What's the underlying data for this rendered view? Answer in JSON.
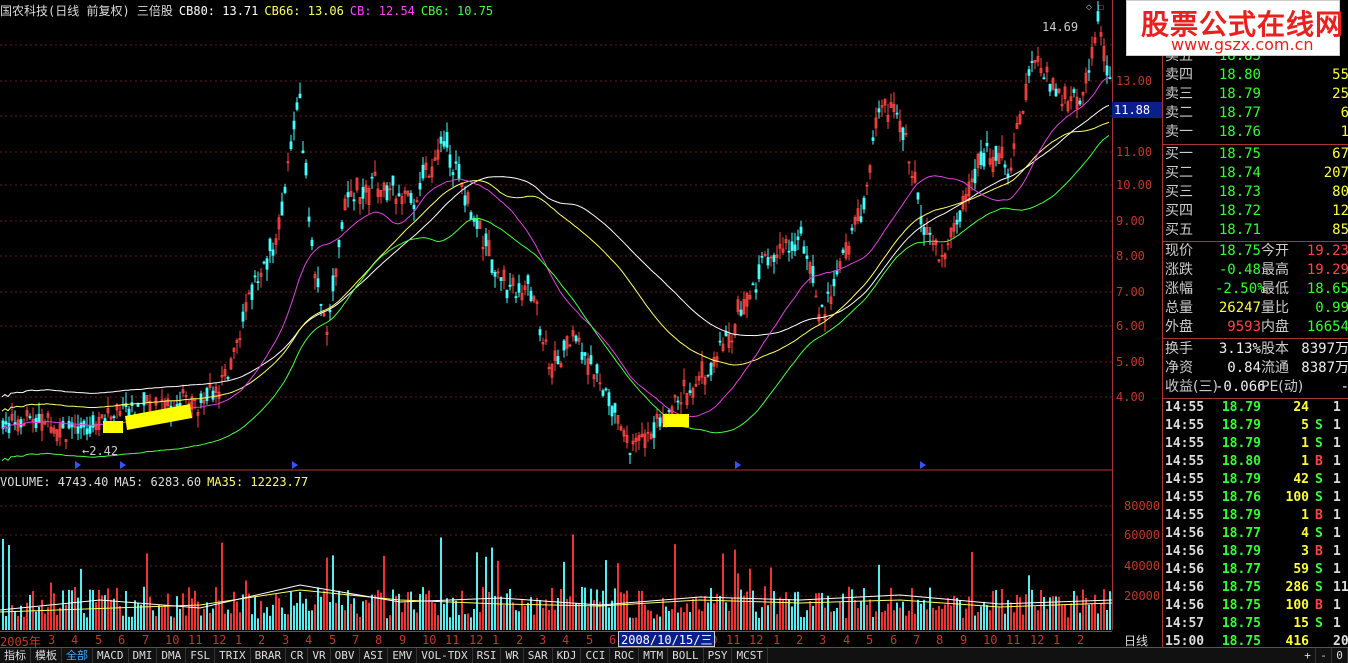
{
  "title": {
    "stock": "国农科技(日线 前复权) 三倍股",
    "items": [
      {
        "label": "CB80: 13.71",
        "color": "#ffffff"
      },
      {
        "label": "CB66: 13.06",
        "color": "#ffff66"
      },
      {
        "label": "CB: 12.54",
        "color": "#ff44ff"
      },
      {
        "label": "CB6: 10.75",
        "color": "#44ff44"
      }
    ]
  },
  "volume_title": {
    "items": [
      {
        "label": "VOLUME: 4743.40",
        "color": "#dddddd"
      },
      {
        "label": "MA5: 6283.60",
        "color": "#dddddd"
      },
      {
        "label": "MA35: 12223.77",
        "color": "#ffff66"
      }
    ]
  },
  "price_axis": [
    "13.00",
    "12.00",
    "11.00",
    "10.00",
    "9.00",
    "8.00",
    "7.00",
    "6.00",
    "5.00",
    "4.00"
  ],
  "current_price_tag": "11.88",
  "volume_axis": [
    "80000",
    "60000",
    "40000",
    "20000"
  ],
  "hi_label": "14.69",
  "lo_label": "←2.42",
  "date_axis": [
    "2005年",
    "3",
    "4",
    "5",
    "6",
    "7",
    "10",
    "11",
    "12",
    "1",
    "2",
    "3",
    "4",
    "5",
    "7",
    "8",
    "9",
    "10",
    "11",
    "12",
    "1",
    "2",
    "3",
    "4",
    "5",
    "6",
    "7",
    "8",
    "9",
    "10",
    "11",
    "12",
    "1",
    "2",
    "3",
    "4",
    "5",
    "6",
    "7",
    "8",
    "9",
    "10",
    "11",
    "12",
    "1",
    "2"
  ],
  "date_highlight": "2008/10/15/三",
  "period_label": "日线",
  "tabs": [
    "指标",
    "模板",
    "全部",
    "MACD",
    "DMI",
    "DMA",
    "FSL",
    "TRIX",
    "BRAR",
    "CR",
    "VR",
    "OBV",
    "ASI",
    "EMV",
    "VOL-TDX",
    "RSI",
    "WR",
    "SAR",
    "KDJ",
    "CCI",
    "ROC",
    "MTM",
    "BOLL",
    "PSY",
    "MCST"
  ],
  "tab_controls": [
    "+",
    "-",
    "0"
  ],
  "watermark": {
    "title": "股票公式在线网",
    "url": "www.gszx.com.cn"
  },
  "order_book": {
    "sell": [
      {
        "label": "卖五",
        "price": "18.83",
        "vol": ""
      },
      {
        "label": "卖四",
        "price": "18.80",
        "vol": "55"
      },
      {
        "label": "卖三",
        "price": "18.79",
        "vol": "25"
      },
      {
        "label": "卖二",
        "price": "18.77",
        "vol": "6"
      },
      {
        "label": "卖一",
        "price": "18.76",
        "vol": "1"
      }
    ],
    "buy": [
      {
        "label": "买一",
        "price": "18.75",
        "vol": "67"
      },
      {
        "label": "买二",
        "price": "18.74",
        "vol": "207"
      },
      {
        "label": "买三",
        "price": "18.73",
        "vol": "80"
      },
      {
        "label": "买四",
        "price": "18.72",
        "vol": "12"
      },
      {
        "label": "买五",
        "price": "18.71",
        "vol": "85"
      }
    ]
  },
  "quote": [
    {
      "l1": "现价",
      "v1": "18.75",
      "c1": "#3f3",
      "l2": "今开",
      "v2": "19.23",
      "c2": "#f44"
    },
    {
      "l1": "涨跌",
      "v1": "-0.48",
      "c1": "#3f3",
      "l2": "最高",
      "v2": "19.29",
      "c2": "#f44"
    },
    {
      "l1": "涨幅",
      "v1": "-2.50%",
      "c1": "#3f3",
      "l2": "最低",
      "v2": "18.65",
      "c2": "#3f3"
    },
    {
      "l1": "总量",
      "v1": "26247",
      "c1": "#ff3",
      "l2": "量比",
      "v2": "0.99",
      "c2": "#3f3"
    },
    {
      "l1": "外盘",
      "v1": "9593",
      "c1": "#f44",
      "l2": "内盘",
      "v2": "16654",
      "c2": "#3f3"
    }
  ],
  "fundamentals": [
    {
      "l1": "换手",
      "v1": "3.13%",
      "l2": "股本",
      "v2": "8397万"
    },
    {
      "l1": "净资",
      "v1": "0.84",
      "l2": "流通",
      "v2": "8387万"
    },
    {
      "l1": "收益(三)",
      "v1": "-0.066",
      "l2": "PE(动)",
      "v2": "-"
    }
  ],
  "ticks": [
    {
      "t": "14:55",
      "p": "18.79",
      "q": "24",
      "bs": "",
      "n": "1"
    },
    {
      "t": "14:55",
      "p": "18.79",
      "q": "5",
      "bs": "S",
      "n": "1"
    },
    {
      "t": "14:55",
      "p": "18.79",
      "q": "1",
      "bs": "S",
      "n": "1"
    },
    {
      "t": "14:55",
      "p": "18.80",
      "q": "1",
      "bs": "B",
      "n": "1"
    },
    {
      "t": "14:55",
      "p": "18.79",
      "q": "42",
      "bs": "S",
      "n": "1"
    },
    {
      "t": "14:55",
      "p": "18.76",
      "q": "100",
      "bs": "S",
      "n": "1"
    },
    {
      "t": "14:55",
      "p": "18.79",
      "q": "1",
      "bs": "B",
      "n": "1"
    },
    {
      "t": "14:56",
      "p": "18.77",
      "q": "4",
      "bs": "S",
      "n": "1"
    },
    {
      "t": "14:56",
      "p": "18.79",
      "q": "3",
      "bs": "B",
      "n": "1"
    },
    {
      "t": "14:56",
      "p": "18.77",
      "q": "59",
      "bs": "S",
      "n": "1"
    },
    {
      "t": "14:56",
      "p": "18.75",
      "q": "286",
      "bs": "S",
      "n": "11"
    },
    {
      "t": "14:56",
      "p": "18.75",
      "q": "100",
      "bs": "B",
      "n": "1"
    },
    {
      "t": "14:57",
      "p": "18.75",
      "q": "15",
      "bs": "S",
      "n": "1"
    },
    {
      "t": "15:00",
      "p": "18.75",
      "q": "416",
      "bs": "",
      "n": "20"
    }
  ],
  "colors": {
    "up": "#ff4444",
    "down": "#44ffff",
    "ma_white": "#ffffff",
    "ma_yellow": "#ffff66",
    "ma_purple": "#dd44dd",
    "ma_green": "#44ff44",
    "highlight": "#ffff00",
    "axis": "#aa3333"
  }
}
